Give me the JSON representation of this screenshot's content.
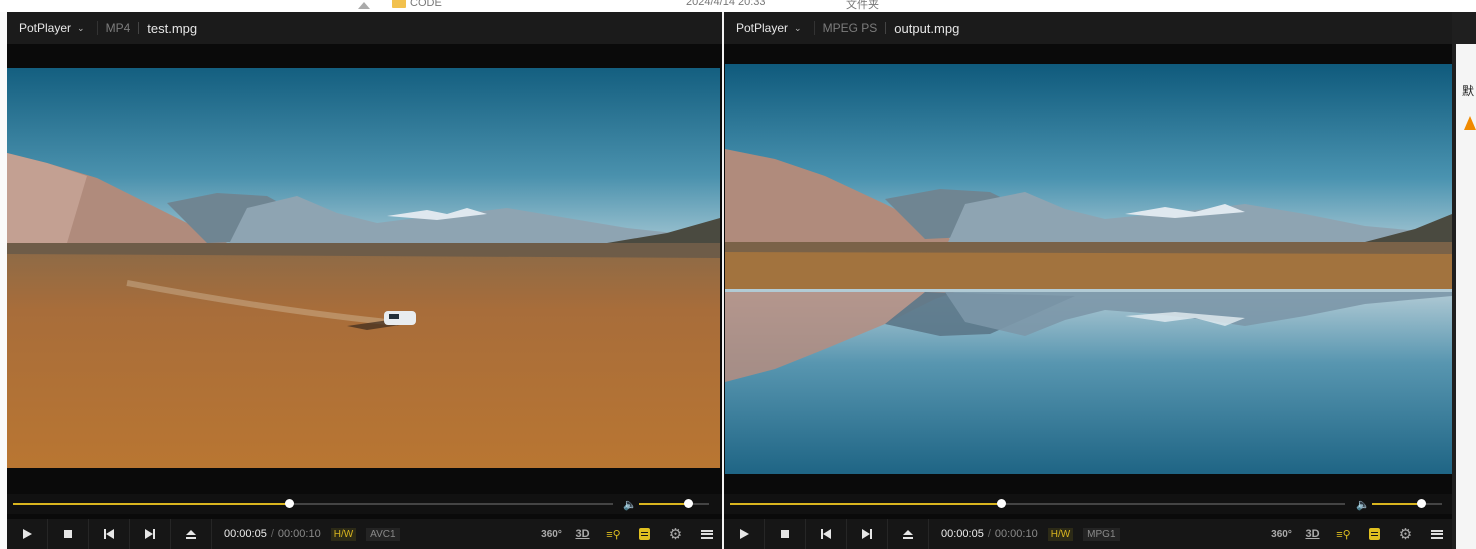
{
  "background": {
    "folder_name": "CODE",
    "folder_date": "2024/4/14 20:33",
    "folder_type": "文件夹",
    "right_edge_char": "默"
  },
  "players": [
    {
      "app": "PotPlayer",
      "format": "MP4",
      "filename": "test.mpg",
      "time_current": "00:00:05",
      "time_separator": "/",
      "time_total": "00:00:10",
      "hw_label": "H/W",
      "codec_label": "AVC1",
      "seek_fraction": 0.46,
      "volume_fraction": 0.7,
      "scene": "desert-car"
    },
    {
      "app": "PotPlayer",
      "format": "MPEG PS",
      "filename": "output.mpg",
      "time_current": "00:00:05",
      "time_separator": "/",
      "time_total": "00:00:10",
      "hw_label": "H/W",
      "codec_label": "MPG1",
      "seek_fraction": 0.44,
      "volume_fraction": 0.7,
      "scene": "lake-reflection"
    }
  ],
  "controls": {
    "label_360": "360°",
    "label_3d": "3D"
  },
  "colors": {
    "accent": "#d9b51f",
    "sky_top": "#1f6d8a",
    "desert": "#a86d3a"
  }
}
